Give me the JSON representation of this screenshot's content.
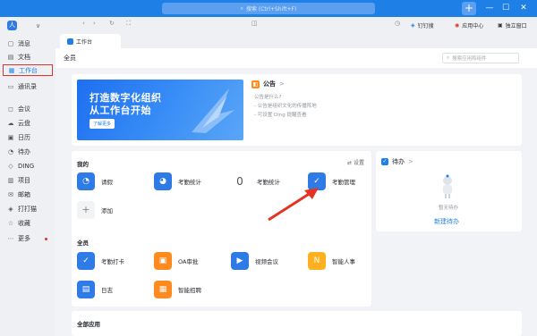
{
  "titlebar": {
    "search_placeholder": "搜索 (Ctrl+Shift+F)",
    "plus": "+",
    "minimize": "—",
    "maximize": "☐",
    "close": "✕"
  },
  "toolbar": {
    "dingbot": "钉钉搜",
    "app_center": "应用中心",
    "standalone": "独立窗口"
  },
  "avatar": {
    "initial": "人",
    "menu": "∨"
  },
  "sidebar": {
    "items": [
      {
        "label": "消息",
        "icon": "chat-icon",
        "glyph": "▢"
      },
      {
        "label": "文档",
        "icon": "document-icon",
        "glyph": "▤"
      },
      {
        "label": "工作台",
        "icon": "workbench-icon",
        "glyph": "▦",
        "active": true
      },
      {
        "label": "通讯录",
        "icon": "contacts-icon",
        "glyph": "▭"
      },
      {
        "label": "会议",
        "icon": "meeting-icon",
        "glyph": "◻"
      },
      {
        "label": "云盘",
        "icon": "cloud-icon",
        "glyph": "☁"
      },
      {
        "label": "日历",
        "icon": "calendar-icon",
        "glyph": "▣"
      },
      {
        "label": "待办",
        "icon": "todo-icon",
        "glyph": "◔"
      },
      {
        "label": "DING",
        "icon": "ding-icon",
        "glyph": "◇"
      },
      {
        "label": "项目",
        "icon": "project-icon",
        "glyph": "▥"
      },
      {
        "label": "邮箱",
        "icon": "mail-icon",
        "glyph": "✉"
      },
      {
        "label": "打打猫",
        "icon": "cat-icon",
        "glyph": "◈"
      },
      {
        "label": "收藏",
        "icon": "star-icon",
        "glyph": "☆"
      },
      {
        "label": "更多",
        "icon": "more-icon",
        "glyph": "⋯"
      }
    ]
  },
  "tab": {
    "label": "工作台"
  },
  "page": {
    "title": "全员",
    "search_placeholder": "搜索应用和组件"
  },
  "banner": {
    "line1": "打造数字化组织",
    "line2": "从工作台开始",
    "button": "了解更多"
  },
  "notice": {
    "title": "公告",
    "chevron": ">",
    "lines": [
      "公告是什么?",
      "- 公告是组织文化的传播阵地",
      "- 可设置 Ding 提醒查看"
    ]
  },
  "my": {
    "title": "我的",
    "settings": "设置",
    "apps": [
      {
        "label": "请假",
        "color": "#2f7be5",
        "glyph": "◔"
      },
      {
        "label": "考勤统计",
        "color": "#2f7be5",
        "glyph": "◕"
      },
      {
        "label": "考勤统计",
        "count": "0"
      },
      {
        "label": "考勤管理",
        "color": "#2f7be5",
        "glyph": "✓"
      },
      {
        "label": "添加",
        "glyph": "+"
      }
    ]
  },
  "all": {
    "title": "全员",
    "apps": [
      {
        "label": "考勤打卡",
        "color": "#2f7be5",
        "glyph": "✓"
      },
      {
        "label": "OA审批",
        "color": "#ff8a1f",
        "glyph": "▣"
      },
      {
        "label": "视频会议",
        "color": "#2f7be5",
        "glyph": "▶"
      },
      {
        "label": "智能人事",
        "color": "#ffb01f",
        "glyph": "N"
      },
      {
        "label": "日志",
        "color": "#2f7be5",
        "glyph": "▤"
      },
      {
        "label": "智能招聘",
        "color": "#ff8a1f",
        "glyph": "▦"
      }
    ]
  },
  "todo": {
    "title": "待办",
    "chevron": ">",
    "empty": "暂无待办",
    "new": "新建待办"
  },
  "allapps": {
    "title": "全部应用"
  },
  "colors": {
    "brand": "#1e7fe6",
    "highlight": "#e0322d"
  }
}
